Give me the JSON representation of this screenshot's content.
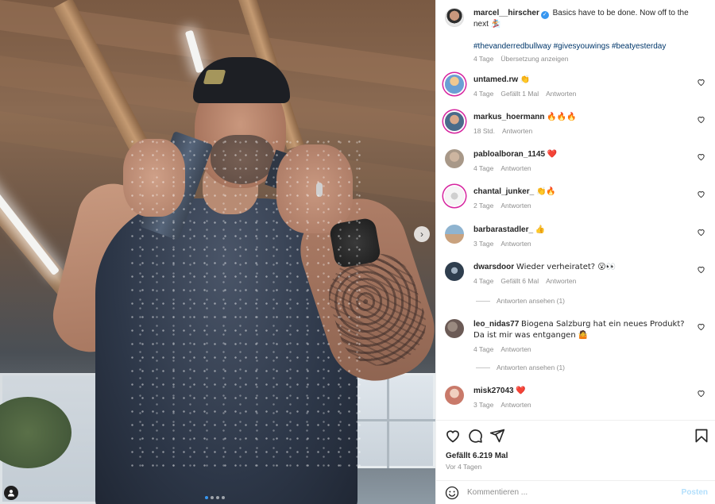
{
  "post": {
    "author": "marcel__hirscher",
    "caption": "Basics have to be done. Now off to the next",
    "caption_emoji": "🏂",
    "hashtags": "#thevanderredbullway #givesyouwings #beatyesterday",
    "time": "4 Tage",
    "translate": "Übersetzung anzeigen",
    "likes": "Gefällt 6.219 Mal",
    "posted_ago": "Vor 4 Tagen"
  },
  "comments": [
    {
      "user": "untamed.rw",
      "text": "👏",
      "time": "4 Tage",
      "likes": "Gefällt 1 Mal",
      "reply": "Antworten",
      "avatar_color": "#6a9fd4"
    },
    {
      "user": "markus_hoermann",
      "text": "🔥🔥🔥",
      "time": "18 Std.",
      "likes": "",
      "reply": "Antworten",
      "avatar_color": "#4a6b8a"
    },
    {
      "user": "pabloalboran_1145",
      "text": "❤️",
      "time": "4 Tage",
      "likes": "",
      "reply": "Antworten",
      "avatar_color": "#b8a898"
    },
    {
      "user": "chantal_junker_",
      "text": "👏🔥",
      "time": "2 Tage",
      "likes": "",
      "reply": "Antworten",
      "avatar_color": "#e8e8e8"
    },
    {
      "user": "barbarastadler_",
      "text": "👍",
      "time": "3 Tage",
      "likes": "",
      "reply": "Antworten",
      "avatar_color": "#7a9ab0"
    },
    {
      "user": "dwarsdoor",
      "text": "Wieder verheiratet? 😮👀",
      "time": "4 Tage",
      "likes": "Gefällt 6 Mal",
      "reply": "Antworten",
      "avatar_color": "#2f3e4e"
    },
    {
      "user": "leo_nidas77",
      "text": "Biogena Salzburg hat ein neues Produkt? Da ist mir was entgangen 🤷",
      "time": "4 Tage",
      "likes": "",
      "reply": "Antworten",
      "avatar_color": "#6b5a55"
    },
    {
      "user": "misk27043",
      "text": "❤️",
      "time": "3 Tage",
      "likes": "",
      "reply": "Antworten",
      "avatar_color": "#c97a6a"
    }
  ],
  "view_replies": "Antworten ansehen (1)",
  "compose": {
    "placeholder": "Kommentieren ...",
    "post_label": "Posten"
  },
  "icons": {
    "like": "heart-icon",
    "comment": "comment-icon",
    "share": "paper-plane-icon",
    "save": "bookmark-icon",
    "emoji": "smiley-icon",
    "next": "chevron-right-icon",
    "tags": "person-icon"
  },
  "colors": {
    "link": "#00376b",
    "muted": "#8e8e8e",
    "verified": "#3897f0",
    "post_button": "#b2dffc"
  }
}
